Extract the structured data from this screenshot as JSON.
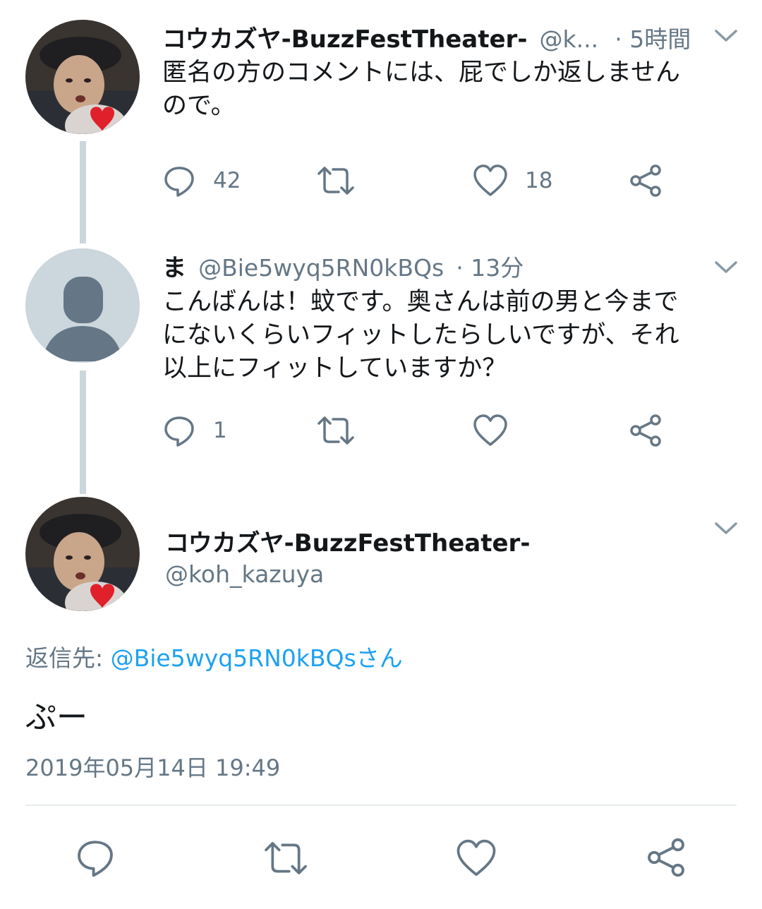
{
  "colors": {
    "text": "#14171a",
    "muted": "#657786",
    "link": "#1da1f2",
    "thread_line": "#ccd6dd",
    "divider": "#e6ecf0"
  },
  "tweet1": {
    "display_name": "コウカズヤ-BuzzFestTheater-",
    "handle": "@k...",
    "time": "· 5時間",
    "text_line1": "匿名の方のコメントには、屁でしか返しません",
    "text_line2": "ので。",
    "reply_count": "42",
    "like_count": "18"
  },
  "tweet2": {
    "display_name": "ま",
    "handle": "@Bie5wyq5RN0kBQs",
    "time": "· 13分",
    "text_line1": "こんばんは！蚊です。奥さんは前の男と今まで",
    "text_line2": "にないくらいフィットしたらしいですが、それ",
    "text_line3": "以上にフィットしていますか？",
    "reply_count": "1"
  },
  "main_tweet": {
    "display_name": "コウカズヤ-BuzzFestTheater-",
    "handle": "@koh_kazuya",
    "reply_prefix": "返信先: ",
    "reply_to": "@Bie5wyq5RN0kBQsさん",
    "text": "ぷー",
    "timestamp": "2019年05月14日 19:49"
  },
  "icons": [
    "reply-icon",
    "retweet-icon",
    "like-icon",
    "share-icon",
    "chevron-down-icon",
    "heart-sticker-icon",
    "default-avatar-icon"
  ]
}
